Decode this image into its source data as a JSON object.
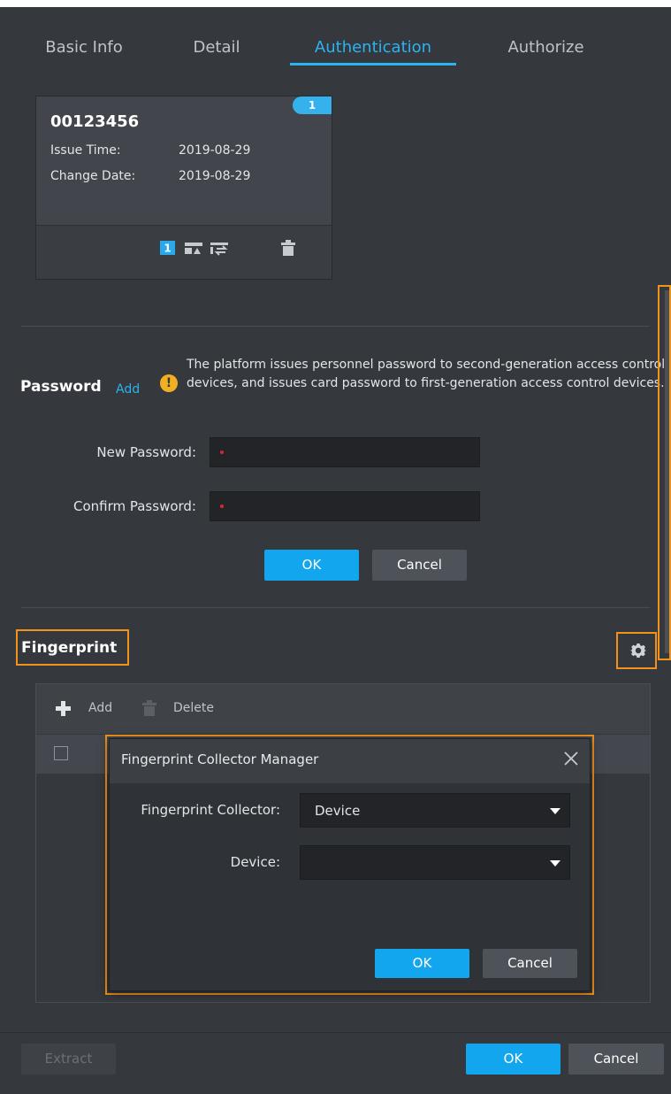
{
  "tabs": [
    {
      "label": "Basic Info",
      "active": false
    },
    {
      "label": "Detail",
      "active": false
    },
    {
      "label": "Authentication",
      "active": true
    },
    {
      "label": "Authorize",
      "active": false
    }
  ],
  "card": {
    "badge": "1",
    "number": "00123456",
    "issue_time_label": "Issue Time:",
    "issue_time": "2019-08-29",
    "change_date_label": "Change Date:",
    "change_date": "2019-08-29",
    "actions": [
      "main-card-icon",
      "issue-card-icon",
      "replace-card-icon",
      "delete-icon"
    ],
    "main_card_text": "1"
  },
  "password": {
    "title": "Password",
    "add_label": "Add",
    "hint": "The platform issues personnel password to second-generation access control devices, and issues card password to first-generation access control devices.",
    "new_label": "New Password:",
    "confirm_label": "Confirm Password:",
    "new_value": "",
    "confirm_value": "",
    "ok": "OK",
    "cancel": "Cancel"
  },
  "fingerprint": {
    "title": "Fingerprint",
    "add_label": "Add",
    "delete_label": "Delete"
  },
  "modal": {
    "title": "Fingerprint Collector Manager",
    "collector_label": "Fingerprint Collector:",
    "collector_value": "Device",
    "device_label": "Device:",
    "device_value": "",
    "ok": "OK",
    "cancel": "Cancel"
  },
  "footer": {
    "extract": "Extract",
    "ok": "OK",
    "cancel": "Cancel"
  },
  "colors": {
    "accent": "#2bb3f2",
    "primary_button": "#12a6ef",
    "highlight": "#f0921c",
    "warning": "#f0b021",
    "background": "#35383d"
  }
}
